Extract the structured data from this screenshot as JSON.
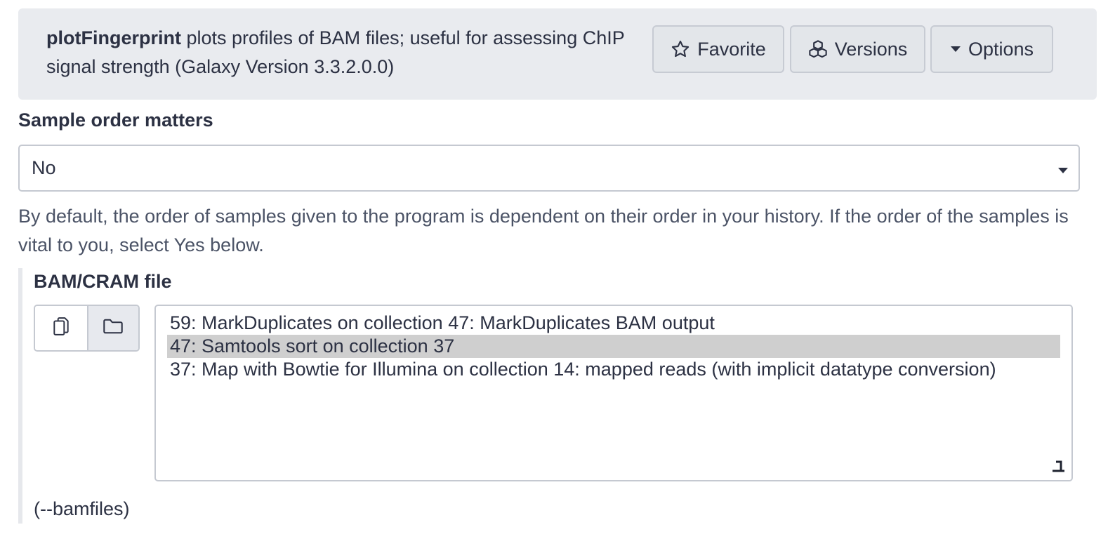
{
  "header": {
    "tool_name": "plotFingerprint",
    "description": " plots profiles of BAM files; useful for assessing ChIP signal strength (Galaxy Version 3.3.2.0.0)",
    "buttons": {
      "favorite": "Favorite",
      "versions": "Versions",
      "options": "Options"
    }
  },
  "sample_order": {
    "label": "Sample order matters",
    "selected_value": "No",
    "help": "By default, the order of samples given to the program is dependent on their order in your history. If the order of the samples is vital to you, select Yes below."
  },
  "bam_input": {
    "label": "BAM/CRAM file",
    "items": [
      {
        "text": "59: MarkDuplicates on collection 47: MarkDuplicates BAM output",
        "selected": false
      },
      {
        "text": "47: Samtools sort on collection 37",
        "selected": true
      },
      {
        "text": "37: Map with Bowtie for Illumina on collection 14: mapped reads (with implicit datatype conversion)",
        "selected": false
      }
    ],
    "argument": "(--bamfiles)"
  },
  "icons": {
    "favorite": "star-icon",
    "versions": "cubes-icon",
    "options": "caret-down-icon",
    "multiple": "copy-icon",
    "collection": "folder-icon",
    "resize": "resize-handle-icon"
  }
}
